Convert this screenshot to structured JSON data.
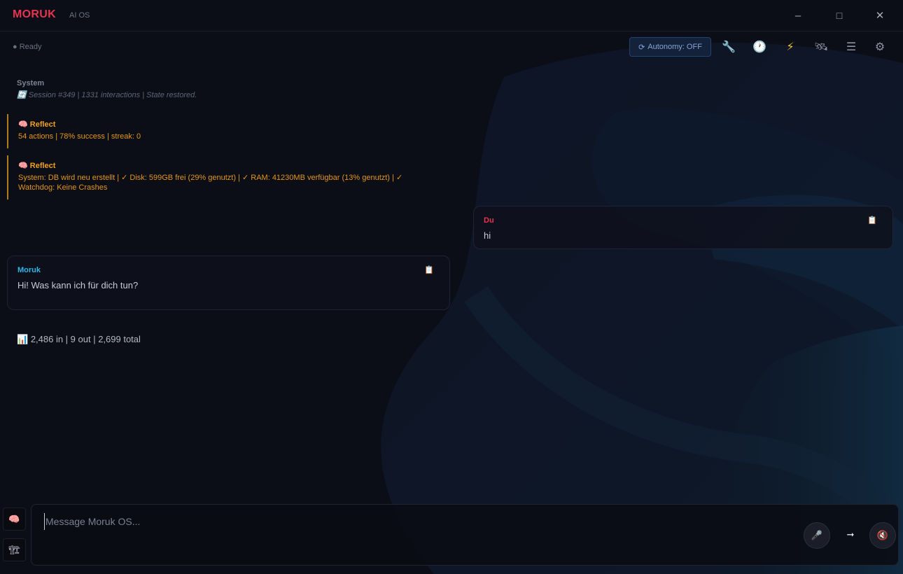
{
  "app": {
    "title": "MORUK",
    "subtitle": "AI OS"
  },
  "window_controls": {
    "minimize": "–",
    "maximize": "□",
    "close": "✕"
  },
  "toolbar": {
    "status_dot": "●",
    "status": "Ready",
    "autonomy_icon": "⟳",
    "autonomy_label": "Autonomy: OFF",
    "tools": [
      {
        "icon": "wrench-icon",
        "glyph": "🔧"
      },
      {
        "icon": "clock-icon",
        "glyph": "🕐"
      },
      {
        "icon": "lightning-icon",
        "glyph": "⚡"
      },
      {
        "icon": "satellite-icon",
        "glyph": "🛰"
      },
      {
        "icon": "menu-icon",
        "glyph": "☰"
      },
      {
        "icon": "gear-icon",
        "glyph": "⚙"
      }
    ]
  },
  "messages": {
    "system": {
      "title": "System",
      "icon": "🔄",
      "text": "Session #349 | 1331 interactions | State restored."
    },
    "reflect_1": {
      "icon": "🧠",
      "title": "Reflect",
      "text": "54 actions | 78% success | streak: 0"
    },
    "reflect_2": {
      "icon": "🧠",
      "title": "Reflect",
      "text": "System: DB wird neu erstellt | ✓ Disk: 599GB frei (29% genutzt) | ✓ RAM: 41230MB verfügbar (13% genutzt) | ✓ Watchdog: Keine Crashes"
    },
    "user": {
      "sender": "Du",
      "text": "hi",
      "copy_icon": "📋"
    },
    "assistant": {
      "sender": "Moruk",
      "text": "Hi! Was kann ich für dich tun?",
      "copy_icon": "📋"
    },
    "tokens": {
      "icon": "📊",
      "text": "2,486 in | 9 out | 2,699 total"
    }
  },
  "composer": {
    "placeholder": "Message Moruk OS...",
    "value": "",
    "brain_icon": "🧠",
    "build_icon": "🏗",
    "mic_icon": "🎤",
    "send_icon": "➞",
    "mute_icon": "🔇"
  },
  "colors": {
    "brand": "#e8344e",
    "assistant": "#2fb8e6",
    "reflect": "#f0a020",
    "background": "#0b0d17"
  }
}
